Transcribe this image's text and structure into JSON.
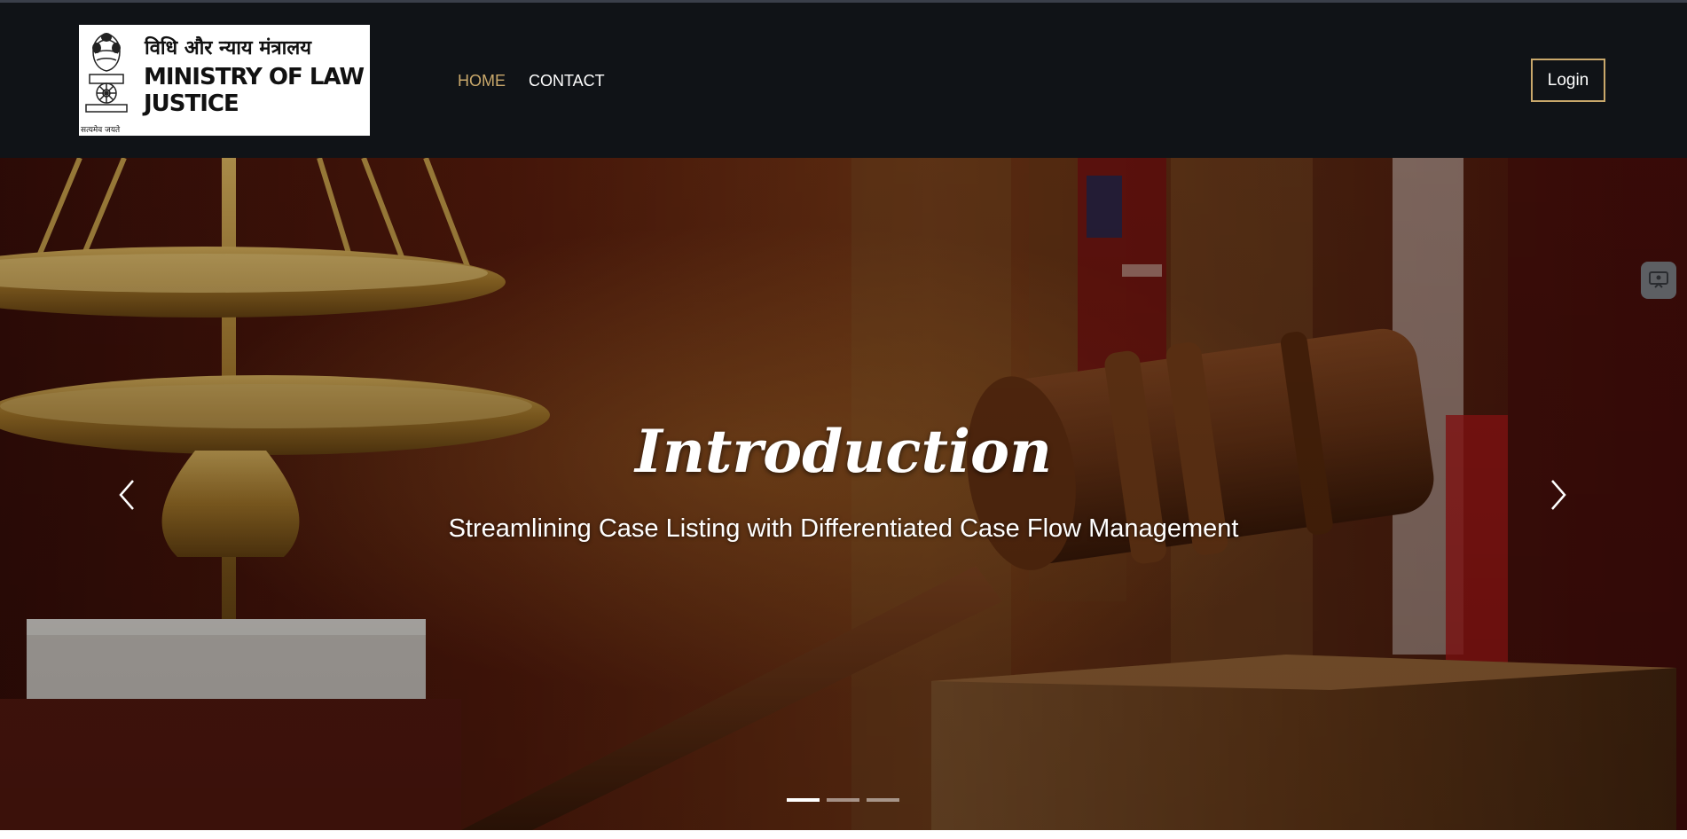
{
  "logo": {
    "hindi_text": "विधि और न्याय मंत्रालय",
    "english_line1": "MINISTRY OF LAW &",
    "english_line2": "JUSTICE",
    "motto": "सत्यमेव जयते"
  },
  "nav": {
    "items": [
      {
        "label": "HOME",
        "active": true
      },
      {
        "label": "CONTACT",
        "active": false
      }
    ]
  },
  "header": {
    "login_label": "Login"
  },
  "hero": {
    "title": "Introduction",
    "subtitle": "Streamlining Case Listing with Differentiated Case Flow Management",
    "slide_count": 3,
    "active_slide": 1
  },
  "colors": {
    "header_bg": "#101317",
    "accent": "#c9a86b",
    "text": "#ffffff"
  },
  "icons": {
    "prev": "chevron-left-icon",
    "next": "chevron-right-icon",
    "widget": "screen-icon"
  }
}
